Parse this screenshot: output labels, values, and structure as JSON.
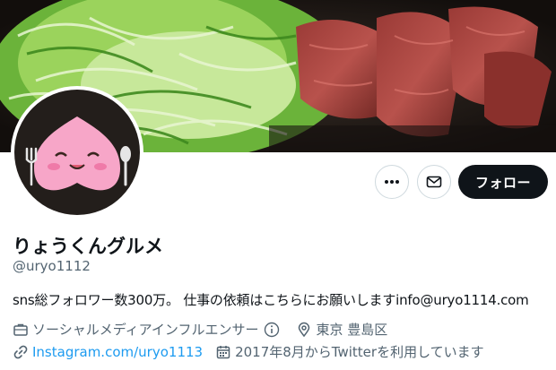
{
  "profile": {
    "display_name": "りょうくんグルメ",
    "handle": "@uryo1112",
    "bio": "sns総フォロワー数300万。 仕事の依頼はこちらにお願いしますinfo@uryo1114.com",
    "category": "ソーシャルメディアインフルエンサー",
    "location": "東京 豊島区",
    "website": "Instagram.com/uryo1113",
    "joined": "2017年8月からTwitterを利用しています"
  },
  "actions": {
    "follow_label": "フォロー"
  },
  "icons": {
    "more": "more-icon",
    "mail": "mail-icon",
    "category": "briefcase-icon",
    "info": "info-icon",
    "location": "location-pin-icon",
    "link": "link-icon",
    "calendar": "calendar-icon"
  },
  "colors": {
    "link": "#1d9bf0",
    "secondary_text": "#536471",
    "follow_bg": "#0f1419",
    "avatar_peach": "#f7a6c8"
  }
}
